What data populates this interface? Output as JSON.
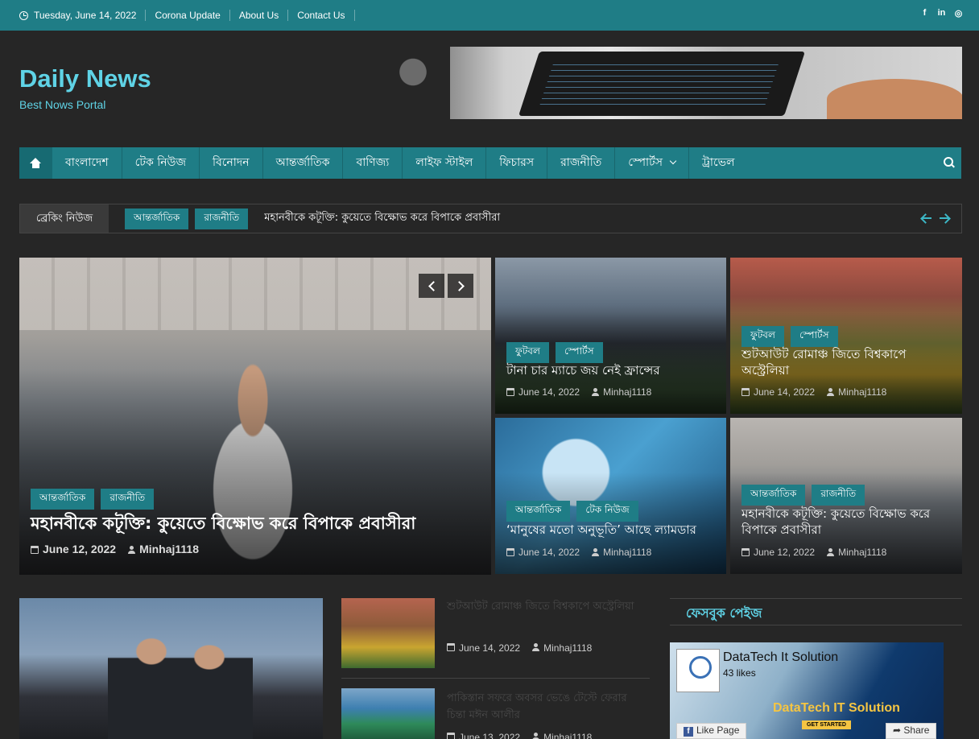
{
  "topbar": {
    "date": "Tuesday, June 14, 2022",
    "links": [
      "Corona Update",
      "About Us",
      "Contact Us"
    ],
    "social": {
      "facebook": "f",
      "linkedin": "in",
      "instagram": "◎"
    }
  },
  "header": {
    "title": "Daily News",
    "tagline": "Best Nows Portal"
  },
  "nav": {
    "items": [
      "বাংলাদেশ",
      "টেক নিউজ",
      "বিনোদন",
      "আন্তর্জাতিক",
      "বাণিজ্য",
      "লাইফ স্টাইল",
      "ফিচারস",
      "রাজনীতি",
      "স্পোর্টস",
      "ট্রাভেল"
    ]
  },
  "breaking": {
    "label": "ব্রেকিং নিউজ",
    "cats": [
      "আন্তর্জাতিক",
      "রাজনীতি"
    ],
    "headline": "মহানবীকে কটূক্তি: কুয়েতে বিক্ষোভ করে বিপাকে প্রবাসীরা"
  },
  "featured": {
    "main": {
      "cats": [
        "আন্তর্জাতিক",
        "রাজনীতি"
      ],
      "title": "মহানবীকে কটূক্তি: কুয়েতে বিক্ষোভ করে বিপাকে প্রবাসীরা",
      "date": "June 12, 2022",
      "author": "Minhaj1118"
    },
    "grid": [
      {
        "cats": [
          "ফুটবল",
          "স্পোর্টস"
        ],
        "title": "টানা চার ম্যাচে জয় নেই ফ্রান্সের",
        "date": "June 14, 2022",
        "author": "Minhaj1118"
      },
      {
        "cats": [
          "ফুটবল",
          "স্পোর্টস"
        ],
        "title": "শুটআউট রোমাঞ্চ জিতে বিশ্বকাপে অস্ট্রেলিয়া",
        "date": "June 14, 2022",
        "author": "Minhaj1118"
      },
      {
        "cats": [
          "আন্তর্জাতিক",
          "টেক নিউজ"
        ],
        "title": "‘মানুষের মতো অনুভূতি’ আছে ল্যামডার",
        "date": "June 14, 2022",
        "author": "Minhaj1118"
      },
      {
        "cats": [
          "আন্তর্জাতিক",
          "রাজনীতি"
        ],
        "title": "মহানবীকে কটূক্তি: কুয়েতে বিক্ষোভ করে বিপাকে প্রবাসীরা",
        "date": "June 12, 2022",
        "author": "Minhaj1118"
      }
    ]
  },
  "list": [
    {
      "title": "শুটআউট রোমাঞ্চ জিতে বিশ্বকাপে অস্ট্রেলিয়া",
      "date": "June 14, 2022",
      "author": "Minhaj1118"
    },
    {
      "title": "পাকিস্তান সফরে অবসর ভেঙে টেস্টে ফেরার চিন্তা মঈন আলীর",
      "date": "June 13, 2022",
      "author": "Minhaj1118"
    }
  ],
  "facebook": {
    "heading": "ফেসবুক পেইজ",
    "page_name": "DataTech It Solution",
    "likes": "43 likes",
    "brand": "DataTech IT Solution",
    "cta": "GET STARTED",
    "like_label": "Like Page",
    "share_label": "Share"
  }
}
